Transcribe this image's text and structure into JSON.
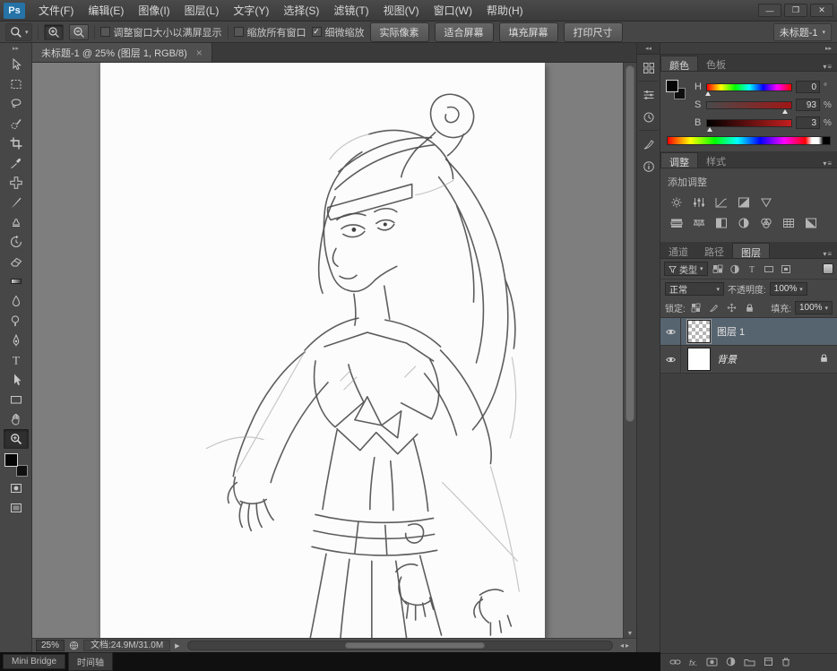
{
  "titlebar": {
    "logo": "Ps",
    "menus": [
      "文件(F)",
      "编辑(E)",
      "图像(I)",
      "图层(L)",
      "文字(Y)",
      "选择(S)",
      "滤镜(T)",
      "视图(V)",
      "窗口(W)",
      "帮助(H)"
    ],
    "window": {
      "minimize": "—",
      "maximize": "❐",
      "close": "✕"
    }
  },
  "options": {
    "checks": [
      {
        "label": "调整窗口大小以满屏显示",
        "checked": false,
        "mark": ""
      },
      {
        "label": "缩放所有窗口",
        "checked": false,
        "mark": ""
      },
      {
        "label": "细微缩放",
        "checked": true,
        "mark": "✓"
      }
    ],
    "buttons": [
      "实际像素",
      "适合屏幕",
      "填充屏幕",
      "打印尺寸"
    ],
    "workspace": "未标题-1",
    "workspace_caret": "▾"
  },
  "doc_tab": {
    "title": "未标题-1 @ 25% (图层 1, RGB/8)",
    "close": "×"
  },
  "tools": [
    "move",
    "rectangular-marquee",
    "lasso",
    "quick-selection",
    "crop",
    "eyedropper",
    "spot-healing",
    "brush",
    "clone-stamp",
    "history-brush",
    "eraser",
    "gradient",
    "blur",
    "dodge",
    "pen",
    "type",
    "path-selection",
    "shape",
    "hand",
    "zoom"
  ],
  "active_tool": "zoom",
  "color_panel": {
    "tabs": [
      "颜色",
      "色板"
    ],
    "sliders": [
      {
        "label": "H",
        "value": "0",
        "unit": "°"
      },
      {
        "label": "S",
        "value": "93",
        "unit": "%"
      },
      {
        "label": "B",
        "value": "3",
        "unit": "%"
      }
    ]
  },
  "adjustments_panel": {
    "tabs": [
      "调整",
      "样式"
    ],
    "add_label": "添加调整"
  },
  "layers_panel": {
    "tabs": [
      "通道",
      "路径",
      "图层"
    ],
    "kind_label": "类型",
    "blend_mode": "正常",
    "opacity_label": "不透明度:",
    "opacity_value": "100%",
    "lock_label": "锁定:",
    "fill_label": "填充:",
    "fill_value": "100%",
    "layers": [
      {
        "name": "图层 1",
        "selected": true
      },
      {
        "name": "背景",
        "locked": true
      }
    ]
  },
  "statusbar": {
    "zoom": "25%",
    "doc_info": "文档:24.9M/31.0M"
  },
  "bottom_tabs": [
    "Mini Bridge",
    "时间轴"
  ],
  "colors": {
    "accent_blue": "#2573a7",
    "selected_layer": "#56646f",
    "canvas_surround": "#7e7e7e"
  }
}
